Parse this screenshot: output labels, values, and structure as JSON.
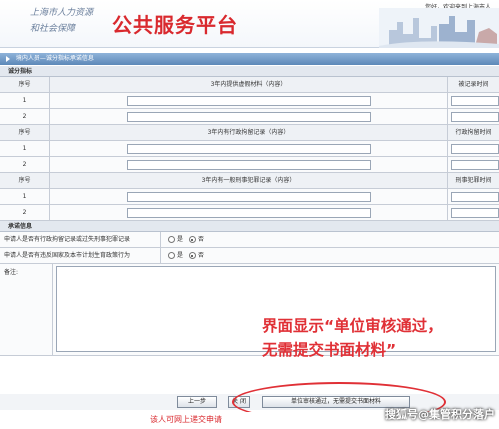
{
  "header": {
    "org_line1": "上海市人力资源",
    "org_line2": "和社会保障",
    "title": "公共服务平台",
    "welcome": "您好，欢迎来到上海市人"
  },
  "section_bar": {
    "label": "境内人员—诚分指标承诺信息"
  },
  "score_section": {
    "label": "诚分指标"
  },
  "tables": [
    {
      "idx_header": "序号",
      "main_header": "3年内提供虚假材料（内容）",
      "side_header": "被记录时间",
      "rows": [
        "1",
        "2"
      ]
    },
    {
      "idx_header": "序号",
      "main_header": "3年内有行政拘留记录（内容）",
      "side_header": "行政拘留时间",
      "rows": [
        "1",
        "2"
      ]
    },
    {
      "idx_header": "序号",
      "main_header": "3年内有一般刑事犯罪记录（内容）",
      "side_header": "刑事犯罪时间",
      "rows": [
        "1",
        "2"
      ]
    }
  ],
  "commitment_section": {
    "label": "承诺信息"
  },
  "commitments": [
    {
      "label": "申请人是否有行政拘留记录或过失刑事犯罪记录",
      "yes": "是",
      "no": "否",
      "selected": "no"
    },
    {
      "label": "申请人是否有违反国家及本市计划生育政策行为",
      "yes": "是",
      "no": "否",
      "selected": "no"
    }
  ],
  "notes": {
    "label": "备注:"
  },
  "annotation": {
    "line1": "界面显示“单位审核通过，",
    "line2": "无需提交书面材料”"
  },
  "buttons": {
    "prev": "上一步",
    "close": "关 闭",
    "status": "单位审核通过，无需提交书面材料"
  },
  "footer": {
    "text": "该人可网上递交申请"
  },
  "watermark": {
    "text": "搜狐号@集管积分落户"
  },
  "colors": {
    "accent_red": "#e03036",
    "title_red": "#d9292e",
    "bar_blue": "#5d88b8"
  }
}
